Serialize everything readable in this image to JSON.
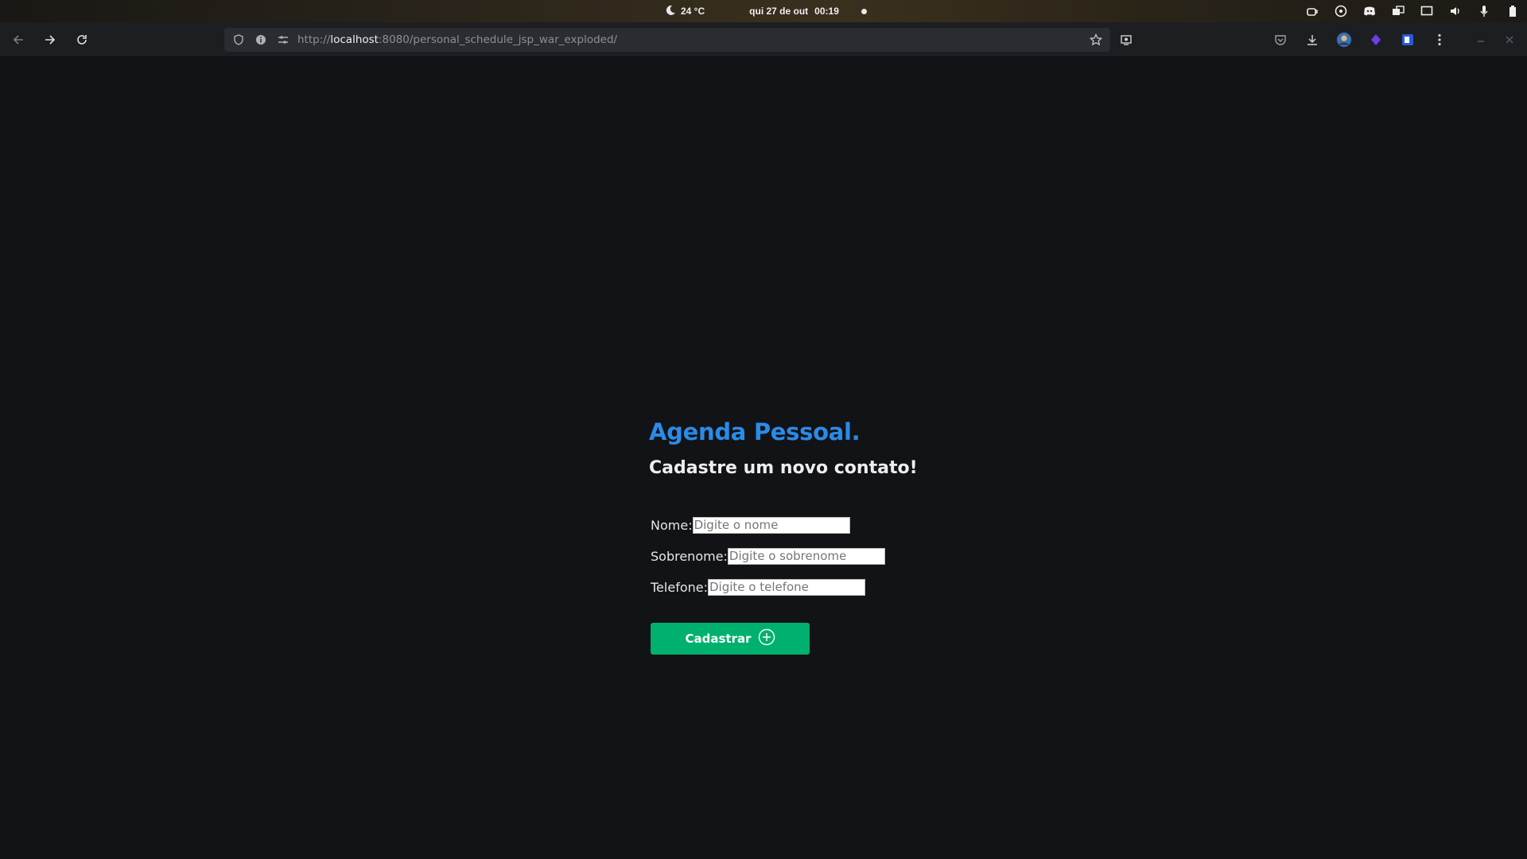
{
  "system_bar": {
    "temperature": "24 °C",
    "date": "qui 27 de out",
    "time": "00:19",
    "icons": [
      "moon-icon",
      "coffee-icon",
      "soccer-ball-icon",
      "discord-icon",
      "window-switch-icon",
      "screen-icon",
      "volume-icon",
      "microphone-icon",
      "battery-icon"
    ]
  },
  "browser": {
    "url_scheme": "http://",
    "url_host": "localhost",
    "url_rest": ":8080/personal_schedule_jsp_war_exploded/",
    "icons": [
      "back-icon",
      "forward-icon",
      "reload-icon",
      "shield-icon",
      "info-icon",
      "site-permissions-icon",
      "bookmark-star-icon",
      "screenshot-icon",
      "pocket-icon",
      "download-icon",
      "profile-avatar-icon",
      "extension-purple-icon",
      "extension-blue-icon",
      "menu-icon",
      "minimize-icon",
      "close-icon"
    ]
  },
  "page": {
    "title": "Agenda Pessoal.",
    "subtitle": "Cadastre um novo contato!",
    "fields": [
      {
        "label": "Nome:",
        "placeholder": "Digite o nome",
        "value": ""
      },
      {
        "label": "Sobrenome:",
        "placeholder": "Digite o sobrenome",
        "value": ""
      },
      {
        "label": "Telefone:",
        "placeholder": "Digite o telefone",
        "value": ""
      }
    ],
    "submit_label": "Cadastrar",
    "submit_icon": "plus-circle-icon"
  },
  "colors": {
    "title": "#2a8be8",
    "button": "#00b06e",
    "background": "#121316"
  }
}
